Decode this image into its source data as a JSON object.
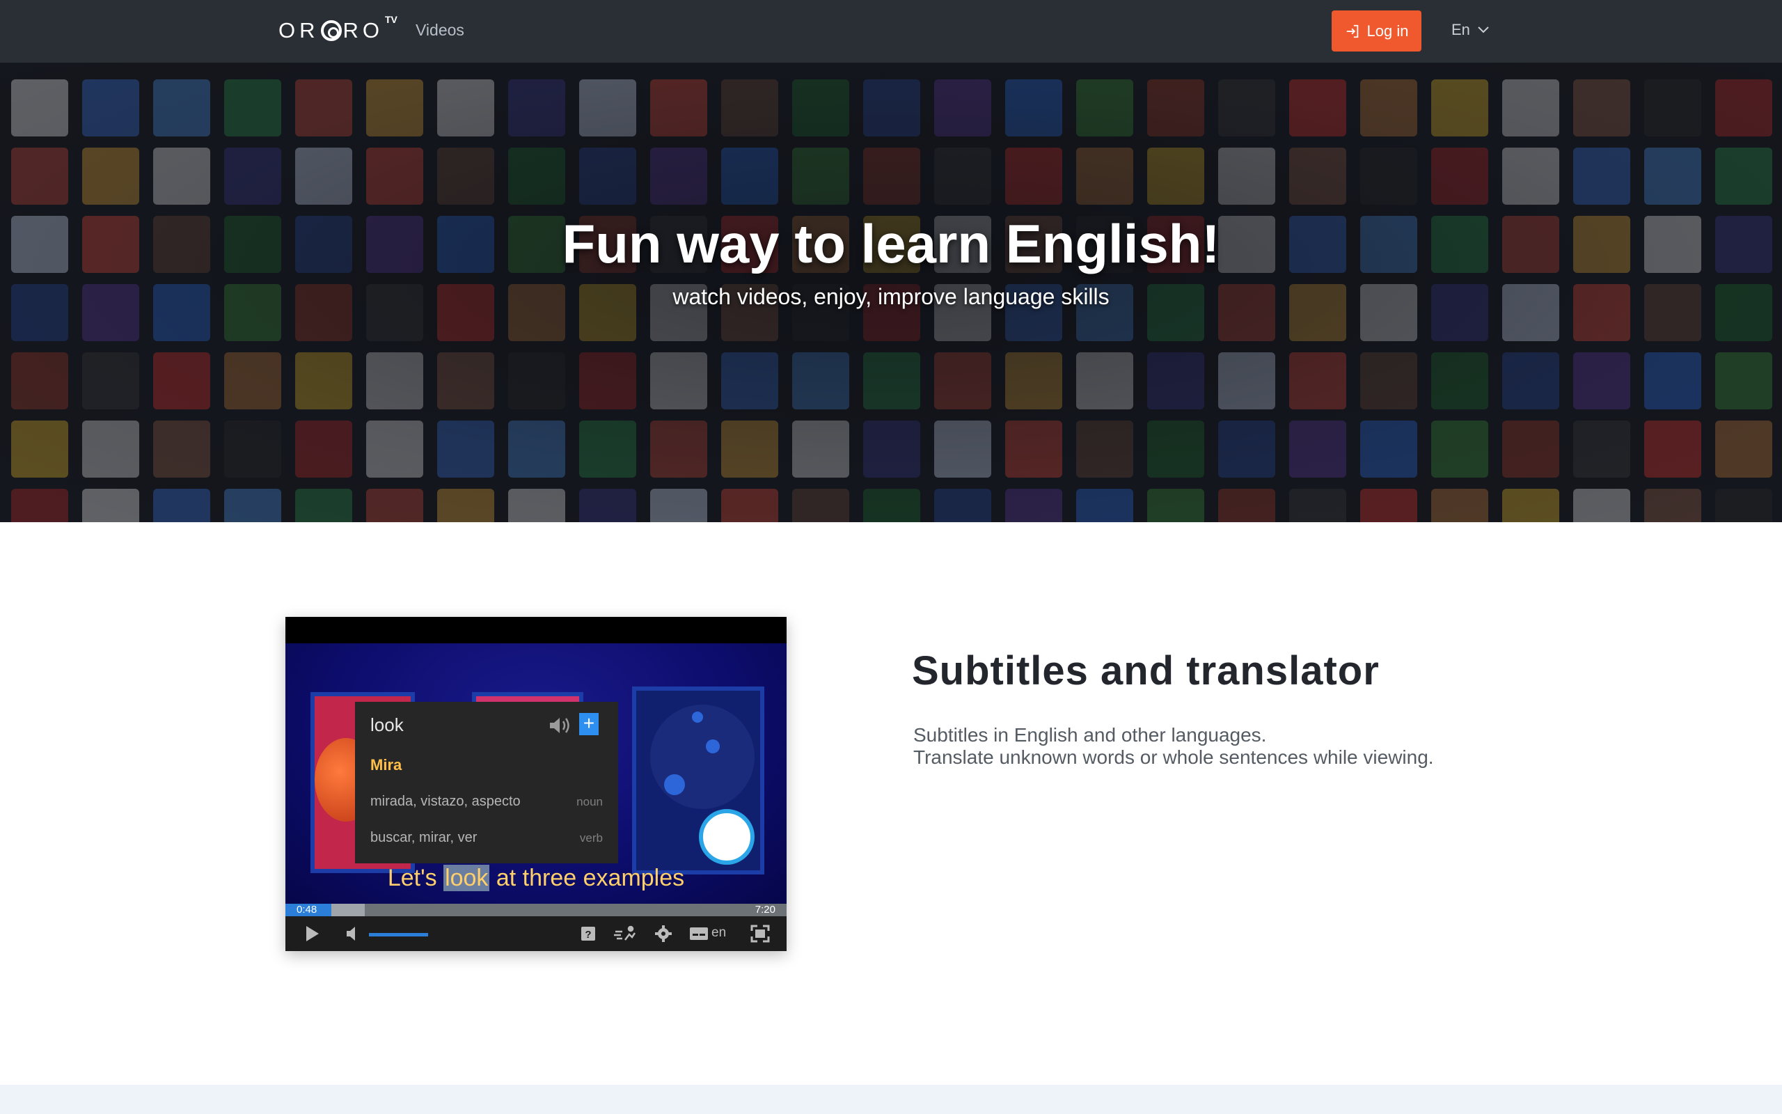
{
  "nav": {
    "logo": "ORORO",
    "logo_suffix": "TV",
    "videos_label": "Videos",
    "login_label": "Log in",
    "language": "En"
  },
  "hero": {
    "title": "Fun way to learn English!",
    "subtitle": "watch videos, enjoy, improve language skills"
  },
  "feature": {
    "title": "Subtitles and translator",
    "description_line1": "Subtitles in English and other languages.",
    "description_line2": "Translate unknown words or whole sentences while viewing."
  },
  "player": {
    "popup_word": "look",
    "popup_translation": "Mira",
    "noun_translations": "mirada, vistazo, aspecto",
    "noun_label": "noun",
    "verb_translations": "buscar, mirar, ver",
    "verb_label": "verb",
    "subtitle_before": "Let's ",
    "subtitle_highlight": "look",
    "subtitle_after": " at three examples",
    "current_time": "0:48",
    "duration": "7:20",
    "subtitle_lang": "en"
  },
  "colors": {
    "nav_bg": "#2a2f36",
    "accent": "#f0592e",
    "hero_bg": "#16191f",
    "popup_translation": "#ffbf4a",
    "progress": "#2b7fd8"
  }
}
